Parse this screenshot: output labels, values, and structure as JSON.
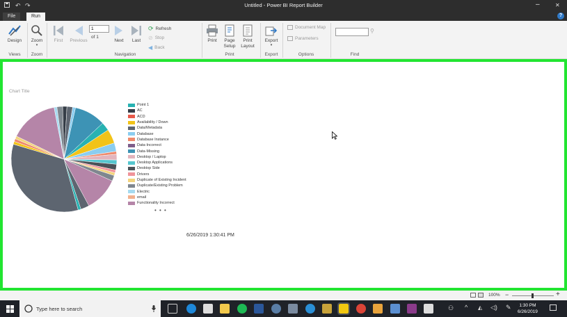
{
  "window": {
    "title": "Untitled - Power BI Report Builder",
    "minimize": "–",
    "close": "✕"
  },
  "tabs": {
    "file": "File",
    "run": "Run"
  },
  "ribbon": {
    "views": {
      "design": "Design",
      "label": "Views"
    },
    "zoom": {
      "zoom": "Zoom",
      "label": "Zoom"
    },
    "navigation": {
      "first": "First",
      "previous": "Previous",
      "page_value": "1",
      "of_text": "of 1",
      "next": "Next",
      "last": "Last",
      "refresh": "Refresh",
      "stop": "Stop",
      "back": "Back",
      "label": "Navigation"
    },
    "print": {
      "print": "Print",
      "page": "Page",
      "setup": "Setup",
      "print2": "Print",
      "layout": "Layout",
      "label": "Print"
    },
    "export": {
      "export": "Export",
      "label": "Export"
    },
    "options": {
      "document_map": "Document Map",
      "parameters": "Parameters",
      "label": "Options"
    },
    "find": {
      "value": "",
      "label": "Find"
    }
  },
  "report": {
    "chart_title": "Chart Title",
    "legend_more": "• • •",
    "timestamp": "6/26/2019 1:30:41 PM"
  },
  "chart_data": {
    "type": "pie",
    "title": "Chart Title",
    "legend_position": "right",
    "legend": [
      {
        "name": "Point 1",
        "color": "#28b2b2"
      },
      {
        "name": "AC",
        "color": "#353d47"
      },
      {
        "name": "ACD",
        "color": "#e8594a"
      },
      {
        "name": "Availability / Down",
        "color": "#f2c318"
      },
      {
        "name": "Data/Metadata",
        "color": "#5d6570"
      },
      {
        "name": "Database",
        "color": "#8bcdf0"
      },
      {
        "name": "Database Instance",
        "color": "#ef8a6c"
      },
      {
        "name": "Data-Incorrect",
        "color": "#7e5d8a"
      },
      {
        "name": "Data-Missing",
        "color": "#3d93b5"
      },
      {
        "name": "Desktop / Laptop",
        "color": "#e3b5bd"
      },
      {
        "name": "Desktop Applications",
        "color": "#56c6cf"
      },
      {
        "name": "Desktop Side",
        "color": "#4c5258"
      },
      {
        "name": "Drivers",
        "color": "#f0939a"
      },
      {
        "name": "Duplicate of Existing Incident",
        "color": "#f3d47c"
      },
      {
        "name": "Duplicate/Existing Problem",
        "color": "#7f878f"
      },
      {
        "name": "Electric",
        "color": "#a6daf0"
      },
      {
        "name": "email",
        "color": "#f2b08e"
      },
      {
        "name": "Functionality Incorrect",
        "color": "#b585a8"
      }
    ],
    "slices": [
      {
        "color": "#3d93b5",
        "value": 11
      },
      {
        "color": "#28b2b2",
        "value": 3
      },
      {
        "color": "#f2c318",
        "value": 5
      },
      {
        "color": "#8bcdf0",
        "value": 3
      },
      {
        "color": "#ef8a6c",
        "value": 1
      },
      {
        "color": "#e3b5bd",
        "value": 2
      },
      {
        "color": "#56c6cf",
        "value": 1.5
      },
      {
        "color": "#4c5258",
        "value": 2
      },
      {
        "color": "#f0939a",
        "value": 1
      },
      {
        "color": "#f3d47c",
        "value": 1
      },
      {
        "color": "#7f878f",
        "value": 2
      },
      {
        "color": "#b585a8",
        "value": 12
      },
      {
        "color": "#5d6570",
        "value": 3
      },
      {
        "color": "#28b2b2",
        "value": 1
      },
      {
        "color": "#5d6570",
        "value": 39
      },
      {
        "color": "#f2c318",
        "value": 1
      },
      {
        "color": "#ef8a6c",
        "value": 1
      },
      {
        "color": "#f3d47c",
        "value": 1
      },
      {
        "color": "#b585a8",
        "value": 17
      },
      {
        "color": "#a6daf0",
        "value": 1
      },
      {
        "color": "#7f878f",
        "value": 2
      },
      {
        "color": "#353d47",
        "value": 1.5
      },
      {
        "color": "#5d6570",
        "value": 2
      },
      {
        "color": "#8bcdf0",
        "value": 1
      }
    ]
  },
  "statusbar": {
    "zoom": "100%"
  },
  "taskbar": {
    "search_placeholder": "Type here to search",
    "time": "1:30 PM",
    "date": "6/26/2019"
  }
}
